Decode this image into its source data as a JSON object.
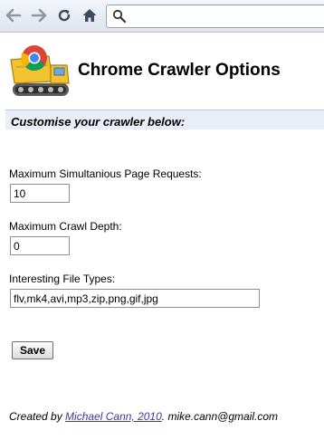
{
  "browser": {
    "icons": {
      "back": "arrow-left-icon",
      "forward": "arrow-right-icon",
      "reload": "reload-icon",
      "home": "home-icon",
      "search": "search-icon"
    },
    "address_value": ""
  },
  "page": {
    "title": "Chrome Crawler Options",
    "banner": "Customise your crawler below:"
  },
  "form": {
    "max_requests_label": "Maximum Simultanious Page Requests:",
    "max_requests_value": "10",
    "max_depth_label": "Maximum Crawl Depth:",
    "max_depth_value": "0",
    "file_types_label": "Interesting File Types:",
    "file_types_value": "flv,mk4,avi,mp3,zip,png,gif,jpg",
    "save_label": "Save"
  },
  "footer": {
    "prefix": "Created by ",
    "author_link": "Michael Cann, 2010",
    "suffix": ". mike.cann@gmail.com"
  },
  "colors": {
    "banner_bg": "#e9eef8",
    "link": "#3b3b9e"
  }
}
